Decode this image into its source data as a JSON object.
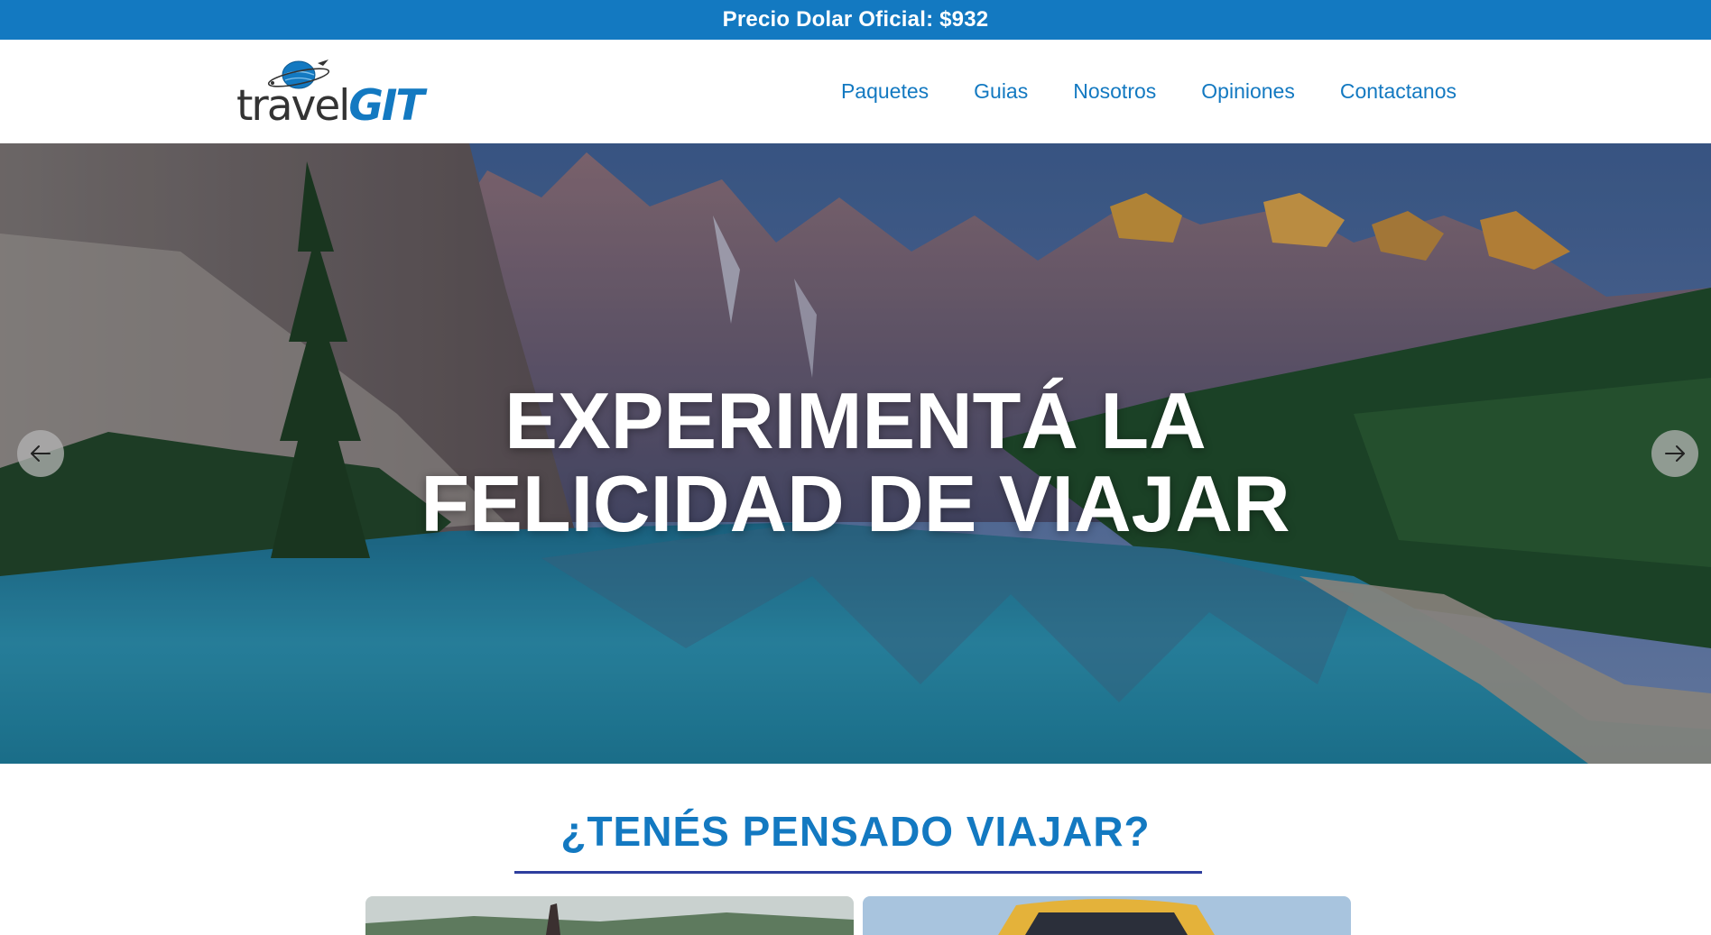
{
  "topbar": {
    "text": "Precio Dolar Oficial: $932"
  },
  "header": {
    "logo": {
      "word1": "travel",
      "word2": "GIT",
      "icon": "globe-plane-icon"
    },
    "nav": [
      {
        "label": "Paquetes"
      },
      {
        "label": "Guias"
      },
      {
        "label": "Nosotros"
      },
      {
        "label": "Opiniones"
      },
      {
        "label": "Contactanos"
      }
    ]
  },
  "hero": {
    "title_line1": "EXPERIMENTÁ LA",
    "title_line2": "FELICIDAD DE VIAJAR",
    "prev_icon": "arrow-left-icon",
    "next_icon": "arrow-right-icon"
  },
  "section": {
    "title": "¿TENÉS PENSADO VIAJAR?"
  },
  "colors": {
    "brand_blue": "#1379c1",
    "underline": "#2e3e9e"
  }
}
